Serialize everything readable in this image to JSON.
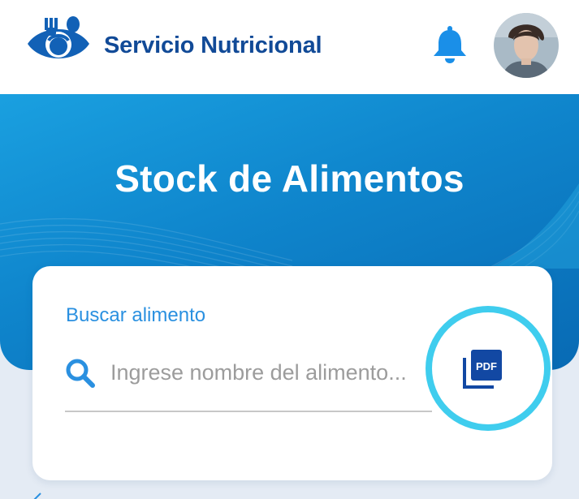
{
  "header": {
    "app_title": "Servicio Nutricional",
    "logo_icon": "nutrition-logo-icon",
    "notifications_icon": "bell-icon",
    "avatar_icon": "user-avatar"
  },
  "hero": {
    "title": "Stock de Alimentos"
  },
  "search_card": {
    "label": "Buscar alimento",
    "search_icon": "search-icon",
    "placeholder": "Ingrese nombre del alimento...",
    "value": "",
    "pdf_button_icon": "pdf-icon"
  },
  "colors": {
    "brand_blue": "#114a97",
    "accent_blue": "#2a90e0",
    "hero_blue": "#0f85cc",
    "highlight_cyan": "#3fcdee"
  }
}
